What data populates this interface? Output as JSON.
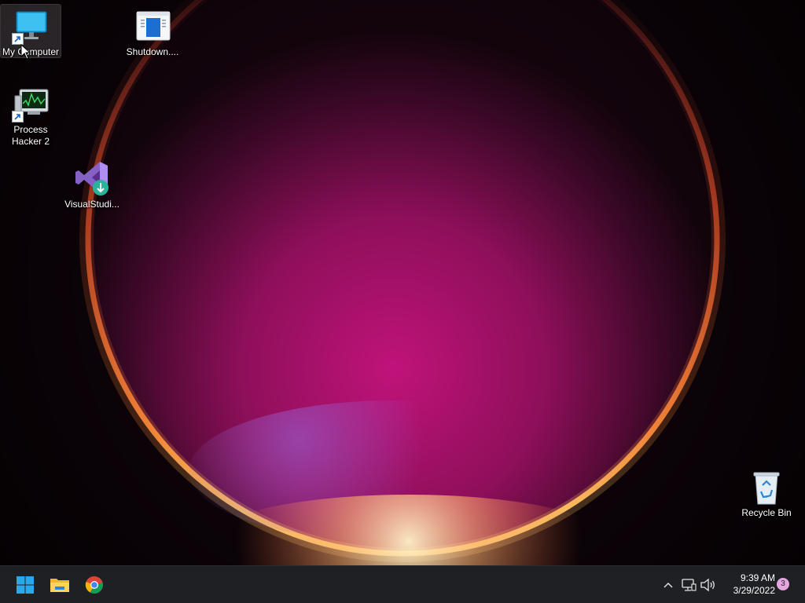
{
  "desktop": {
    "icons": [
      {
        "label": "My Computer",
        "icon": "monitor-icon",
        "shortcut": true,
        "selected": true
      },
      {
        "label": "Shutdown....",
        "icon": "window-icon",
        "shortcut": false,
        "selected": false
      },
      {
        "label": "Process Hacker 2",
        "icon": "process-monitor-icon",
        "shortcut": true,
        "selected": false
      },
      {
        "label": "VisualStudi...",
        "icon": "visual-studio-installer-icon",
        "shortcut": false,
        "selected": false
      },
      {
        "label": "Recycle Bin",
        "icon": "recycle-bin-icon",
        "shortcut": false,
        "selected": false
      }
    ]
  },
  "taskbar": {
    "pinned": [
      {
        "name": "Start",
        "icon": "windows-start-icon"
      },
      {
        "name": "File Explorer",
        "icon": "folder-icon"
      },
      {
        "name": "Google Chrome",
        "icon": "chrome-icon"
      }
    ],
    "tray": {
      "chevron_icon": "chevron-up-icon",
      "network_icon": "network-icon",
      "volume_icon": "volume-icon"
    },
    "clock": {
      "time": "9:39 AM",
      "date": "3/29/2022"
    },
    "notification_count": "3"
  },
  "colors": {
    "taskbar_bg": "#1f2024",
    "accent_blue": "#29a8ec",
    "wallpaper_glow": "#c0137a",
    "notification_badge": "#e7a5e0"
  }
}
